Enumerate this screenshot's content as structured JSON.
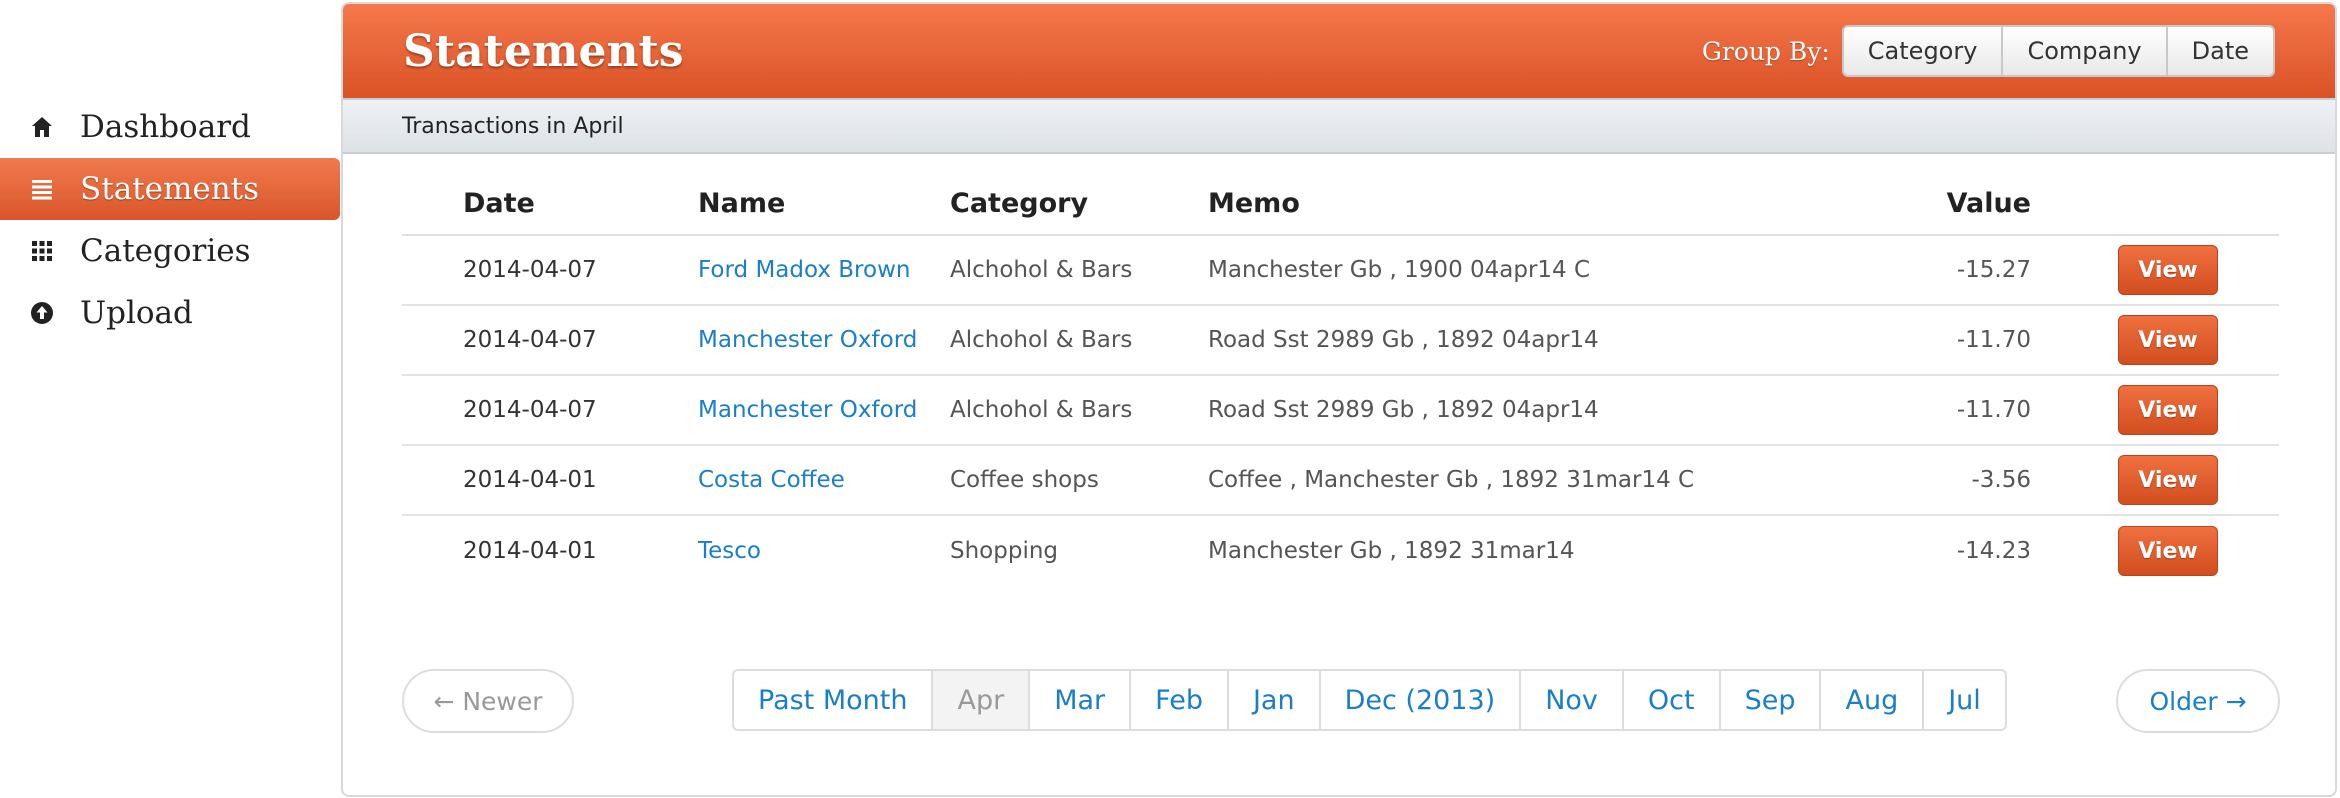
{
  "sidebar": {
    "items": [
      {
        "label": "Dashboard",
        "icon": "home-icon"
      },
      {
        "label": "Statements",
        "icon": "list-icon",
        "active": true
      },
      {
        "label": "Categories",
        "icon": "grid-icon"
      },
      {
        "label": "Upload",
        "icon": "upload-icon"
      }
    ]
  },
  "header": {
    "title": "Statements",
    "group_by_label": "Group By:",
    "group_by_options": [
      "Category",
      "Company",
      "Date"
    ]
  },
  "subheader": {
    "text": "Transactions in April"
  },
  "table": {
    "columns": [
      "Date",
      "Name",
      "Category",
      "Memo",
      "Value"
    ],
    "rows": [
      {
        "date": "2014-04-07",
        "name": "Ford Madox Brown",
        "category": "Alchohol & Bars",
        "memo": "Manchester Gb , 1900 04apr14 C",
        "value": "-15.27",
        "action": "View"
      },
      {
        "date": "2014-04-07",
        "name": "Manchester Oxford",
        "category": "Alchohol & Bars",
        "memo": "Road Sst 2989 Gb , 1892 04apr14",
        "value": "-11.70",
        "action": "View"
      },
      {
        "date": "2014-04-07",
        "name": "Manchester Oxford",
        "category": "Alchohol & Bars",
        "memo": "Road Sst 2989 Gb , 1892 04apr14",
        "value": "-11.70",
        "action": "View"
      },
      {
        "date": "2014-04-01",
        "name": "Costa Coffee",
        "category": "Coffee shops",
        "memo": "Coffee , Manchester Gb , 1892 31mar14 C",
        "value": "-3.56",
        "action": "View"
      },
      {
        "date": "2014-04-01",
        "name": "Tesco",
        "category": "Shopping",
        "memo": "Manchester Gb , 1892 31mar14",
        "value": "-14.23",
        "action": "View"
      }
    ]
  },
  "pagination": {
    "newer": "← Newer",
    "older": "Older →",
    "months": [
      "Past Month",
      "Apr",
      "Mar",
      "Feb",
      "Jan",
      "Dec (2013)",
      "Nov",
      "Oct",
      "Sep",
      "Aug",
      "Jul"
    ],
    "active_month": "Apr"
  },
  "colors": {
    "accent": "#e5612f",
    "link": "#1a7ec8"
  }
}
